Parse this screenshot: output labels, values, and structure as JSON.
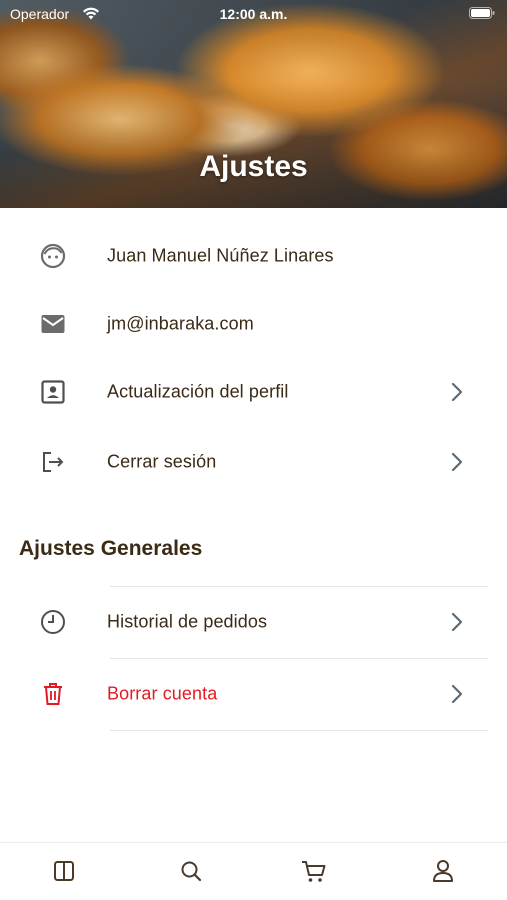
{
  "status_bar": {
    "carrier": "Operador",
    "time": "12:00 a.m."
  },
  "header": {
    "title": "Ajustes"
  },
  "account": {
    "user_name": "Juan Manuel Núñez Linares",
    "email": "jm@inbaraka.com",
    "update_profile": "Actualización del perfil",
    "logout": "Cerrar sesión"
  },
  "general": {
    "title": "Ajustes Generales",
    "order_history": "Historial de pedidos",
    "delete_account": "Borrar cuenta"
  },
  "icons": {
    "user": "face-icon",
    "email": "mail-icon",
    "profile": "contact-card-icon",
    "logout": "logout-icon",
    "history": "clock-icon",
    "delete": "trash-icon",
    "chevron": "chevron-right-icon",
    "tabs": [
      "book-icon",
      "search-icon",
      "cart-icon",
      "person-icon"
    ]
  },
  "colors": {
    "text": "#3a2a16",
    "danger": "#e11b23",
    "icon_gray": "#6b6b6b",
    "chevron": "#5a6b78",
    "tab_icon": "#4a3a2a"
  }
}
